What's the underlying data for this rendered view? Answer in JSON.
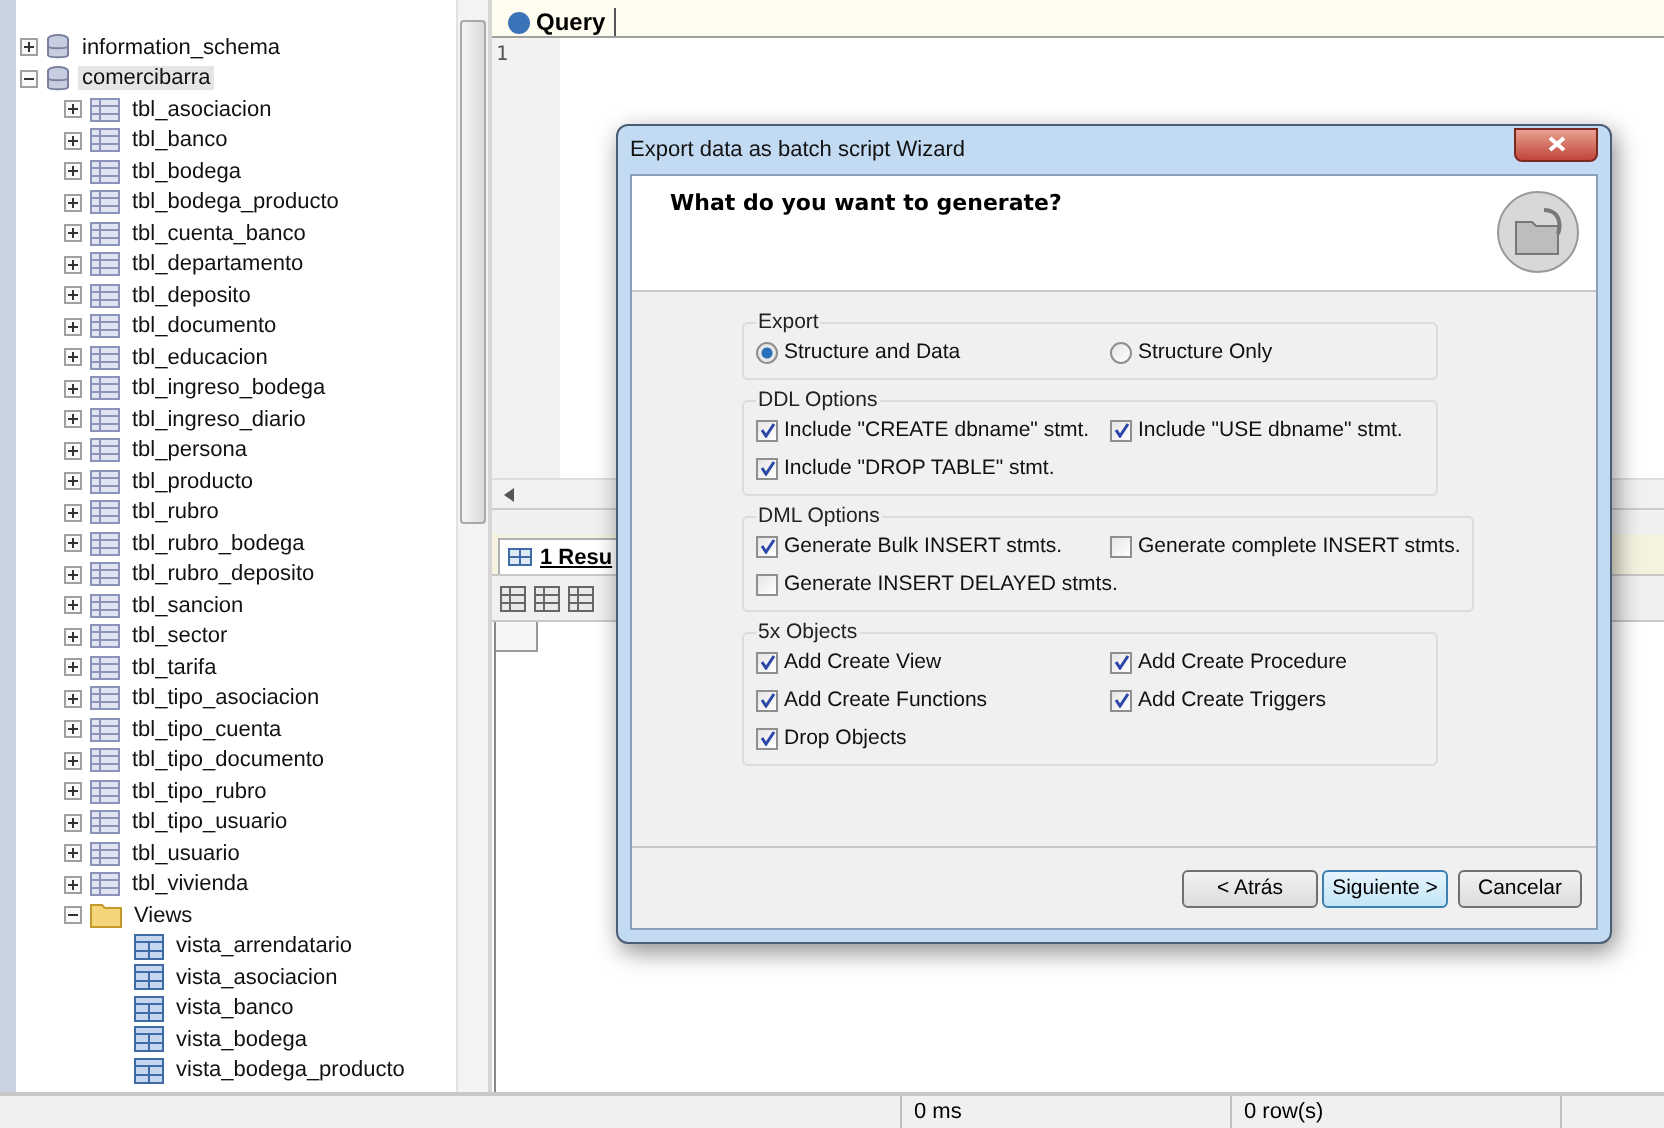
{
  "tree": [
    {
      "kind": "database",
      "label": "information_schema",
      "expanded": false,
      "selected": false
    },
    {
      "kind": "database",
      "label": "comercibarra",
      "expanded": true,
      "selected": true,
      "children": [
        {
          "kind": "table",
          "label": "tbl_asociacion",
          "expanded": false,
          "selected": false
        },
        {
          "kind": "table",
          "label": "tbl_banco",
          "expanded": false,
          "selected": false
        },
        {
          "kind": "table",
          "label": "tbl_bodega",
          "expanded": false,
          "selected": false
        },
        {
          "kind": "table",
          "label": "tbl_bodega_producto",
          "expanded": false,
          "selected": false
        },
        {
          "kind": "table",
          "label": "tbl_cuenta_banco",
          "expanded": false,
          "selected": false
        },
        {
          "kind": "table",
          "label": "tbl_departamento",
          "expanded": false,
          "selected": false
        },
        {
          "kind": "table",
          "label": "tbl_deposito",
          "expanded": false,
          "selected": false
        },
        {
          "kind": "table",
          "label": "tbl_documento",
          "expanded": false,
          "selected": false
        },
        {
          "kind": "table",
          "label": "tbl_educacion",
          "expanded": false,
          "selected": false
        },
        {
          "kind": "table",
          "label": "tbl_ingreso_bodega",
          "expanded": false,
          "selected": false
        },
        {
          "kind": "table",
          "label": "tbl_ingreso_diario",
          "expanded": false,
          "selected": false
        },
        {
          "kind": "table",
          "label": "tbl_persona",
          "expanded": false,
          "selected": false
        },
        {
          "kind": "table",
          "label": "tbl_producto",
          "expanded": false,
          "selected": false
        },
        {
          "kind": "table",
          "label": "tbl_rubro",
          "expanded": false,
          "selected": false
        },
        {
          "kind": "table",
          "label": "tbl_rubro_bodega",
          "expanded": false,
          "selected": false
        },
        {
          "kind": "table",
          "label": "tbl_rubro_deposito",
          "expanded": false,
          "selected": false
        },
        {
          "kind": "table",
          "label": "tbl_sancion",
          "expanded": false,
          "selected": false
        },
        {
          "kind": "table",
          "label": "tbl_sector",
          "expanded": false,
          "selected": false
        },
        {
          "kind": "table",
          "label": "tbl_tarifa",
          "expanded": false,
          "selected": false
        },
        {
          "kind": "table",
          "label": "tbl_tipo_asociacion",
          "expanded": false,
          "selected": false
        },
        {
          "kind": "table",
          "label": "tbl_tipo_cuenta",
          "expanded": false,
          "selected": false
        },
        {
          "kind": "table",
          "label": "tbl_tipo_documento",
          "expanded": false,
          "selected": false
        },
        {
          "kind": "table",
          "label": "tbl_tipo_rubro",
          "expanded": false,
          "selected": false
        },
        {
          "kind": "table",
          "label": "tbl_tipo_usuario",
          "expanded": false,
          "selected": false
        },
        {
          "kind": "table",
          "label": "tbl_usuario",
          "expanded": false,
          "selected": false
        },
        {
          "kind": "table",
          "label": "tbl_vivienda",
          "expanded": false,
          "selected": false
        },
        {
          "kind": "folder",
          "label": "Views",
          "expanded": true,
          "selected": false,
          "children": [
            {
              "kind": "view",
              "label": "vista_arrendatario",
              "selected": false
            },
            {
              "kind": "view",
              "label": "vista_asociacion",
              "selected": false
            },
            {
              "kind": "view",
              "label": "vista_banco",
              "selected": false
            },
            {
              "kind": "view",
              "label": "vista_bodega",
              "selected": false
            },
            {
              "kind": "view",
              "label": "vista_bodega_producto",
              "selected": false
            }
          ]
        }
      ]
    }
  ],
  "query_tab": {
    "label": "Query"
  },
  "editor": {
    "line_numbers": [
      "1"
    ]
  },
  "result_tab": {
    "label": "1 Resu",
    "selected": true
  },
  "dialog": {
    "title": "Export data as batch script Wizard",
    "heading": "What do you want to generate?",
    "groups": [
      {
        "title": "Export",
        "options": [
          {
            "kind": "radio",
            "label": "Structure and Data",
            "selected": true
          },
          {
            "kind": "radio",
            "label": "Structure Only",
            "selected": false
          }
        ]
      },
      {
        "title": "DDL Options",
        "options": [
          {
            "kind": "checkbox",
            "label": "Include \"CREATE dbname\" stmt.",
            "checked": true
          },
          {
            "kind": "checkbox",
            "label": "Include \"USE dbname\" stmt.",
            "checked": true
          },
          {
            "kind": "checkbox",
            "label": "Include \"DROP TABLE\" stmt.",
            "checked": true
          }
        ]
      },
      {
        "title": "DML Options",
        "options": [
          {
            "kind": "checkbox",
            "label": "Generate Bulk INSERT stmts.",
            "checked": true
          },
          {
            "kind": "checkbox",
            "label": "Generate complete INSERT stmts.",
            "checked": false
          },
          {
            "kind": "checkbox",
            "label": "Generate INSERT DELAYED stmts.",
            "checked": false
          }
        ]
      },
      {
        "title": "5x Objects",
        "options": [
          {
            "kind": "checkbox",
            "label": "Add Create View",
            "checked": true
          },
          {
            "kind": "checkbox",
            "label": "Add Create Procedure",
            "checked": true
          },
          {
            "kind": "checkbox",
            "label": "Add Create Functions",
            "checked": true
          },
          {
            "kind": "checkbox",
            "label": "Add Create Triggers",
            "checked": true
          },
          {
            "kind": "checkbox",
            "label": "Drop Objects",
            "checked": true
          }
        ]
      }
    ],
    "buttons": [
      {
        "label": "< Atrás",
        "default": false
      },
      {
        "label": "Siguiente >",
        "default": true
      },
      {
        "label": "Cancelar",
        "default": false
      }
    ]
  },
  "status_bar": [
    "0 ms",
    "0 row(s)"
  ]
}
